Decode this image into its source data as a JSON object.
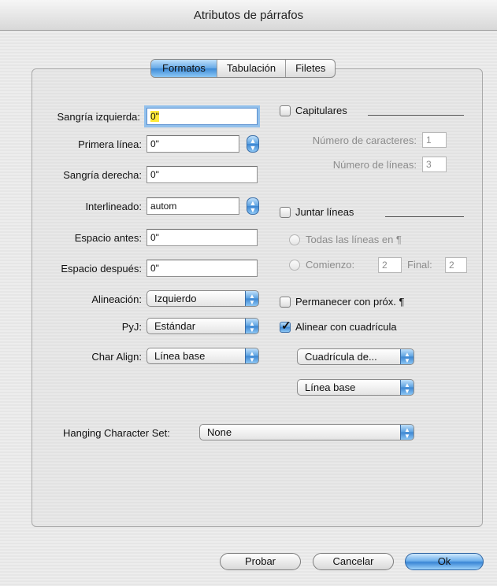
{
  "window": {
    "title": "Atributos de párrafos"
  },
  "tabs": [
    {
      "label": "Formatos",
      "active": true
    },
    {
      "label": "Tabulación",
      "active": false
    },
    {
      "label": "Filetes",
      "active": false
    }
  ],
  "left": {
    "sangria_izq": {
      "label": "Sangría izquierda:",
      "value": "0\""
    },
    "primera_linea": {
      "label": "Primera línea:",
      "value": "0\""
    },
    "sangria_der": {
      "label": "Sangría derecha:",
      "value": "0\""
    },
    "interlineado": {
      "label": "Interlineado:",
      "value": "autom"
    },
    "espacio_antes": {
      "label": "Espacio antes:",
      "value": "0\""
    },
    "espacio_despues": {
      "label": "Espacio después:",
      "value": "0\""
    },
    "alineacion": {
      "label": "Alineación:",
      "value": "Izquierdo"
    },
    "pyj": {
      "label": "PyJ:",
      "value": "Estándar"
    },
    "char_align": {
      "label": "Char Align:",
      "value": "Línea base"
    }
  },
  "right": {
    "capitulares": {
      "label": "Capitulares",
      "checked": false
    },
    "num_caracteres": {
      "label": "Número de caracteres:",
      "value": "1"
    },
    "num_lineas": {
      "label": "Número de líneas:",
      "value": "3"
    },
    "juntar_lineas": {
      "label": "Juntar líneas",
      "checked": false
    },
    "todas_lineas": {
      "label": "Todas las líneas en ¶"
    },
    "comienzo": {
      "label": "Comienzo:",
      "value": "2"
    },
    "final": {
      "label": "Final:",
      "value": "2"
    },
    "permanecer": {
      "label": "Permanecer con próx. ¶",
      "checked": false
    },
    "alinear_cuadricula": {
      "label": "Alinear con cuadrícula",
      "checked": true
    },
    "cuadricula_popup": {
      "value": "Cuadrícula de..."
    },
    "linea_base_popup": {
      "value": "Línea base"
    }
  },
  "hanging": {
    "label": "Hanging Character Set:",
    "value": "None"
  },
  "buttons": {
    "probar": "Probar",
    "cancelar": "Cancelar",
    "ok": "Ok"
  },
  "icons": {
    "stepper": "up-down-arrows",
    "check": "✓"
  },
  "colors": {
    "accent": "#3c86d2",
    "highlight": "#ffea3b",
    "focus_ring": "#93c1ec"
  }
}
